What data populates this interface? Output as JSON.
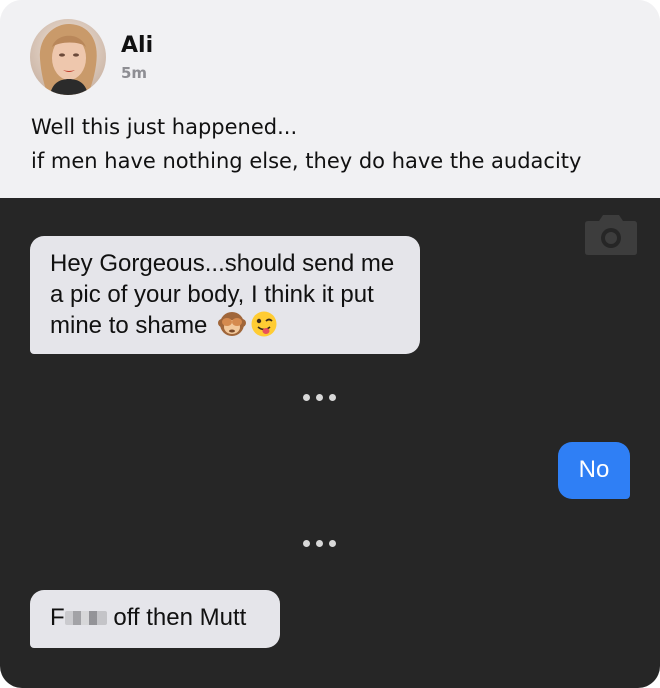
{
  "post": {
    "author_name": "Ali",
    "timestamp": "5m",
    "text_line1": "Well this just happened...",
    "text_line2": "if men have nothing else, they do have the audacity"
  },
  "chat": {
    "messages": [
      {
        "side": "received",
        "text": "Hey Gorgeous...should send me a pic of your body, I think it put mine to shame",
        "emojis": [
          "see-no-evil-monkey-emoji",
          "winking-face-with-tongue-emoji"
        ]
      },
      {
        "side": "sent",
        "text": "No"
      },
      {
        "side": "received",
        "text_prefix": "F",
        "text_suffix": " off then Mutt"
      }
    ],
    "typing_indicators": 2,
    "icons": [
      "camera-icon"
    ],
    "colors": {
      "chat_background": "#262626",
      "received_bubble": "#e5e5ea",
      "sent_bubble": "#2f7ff5"
    }
  }
}
